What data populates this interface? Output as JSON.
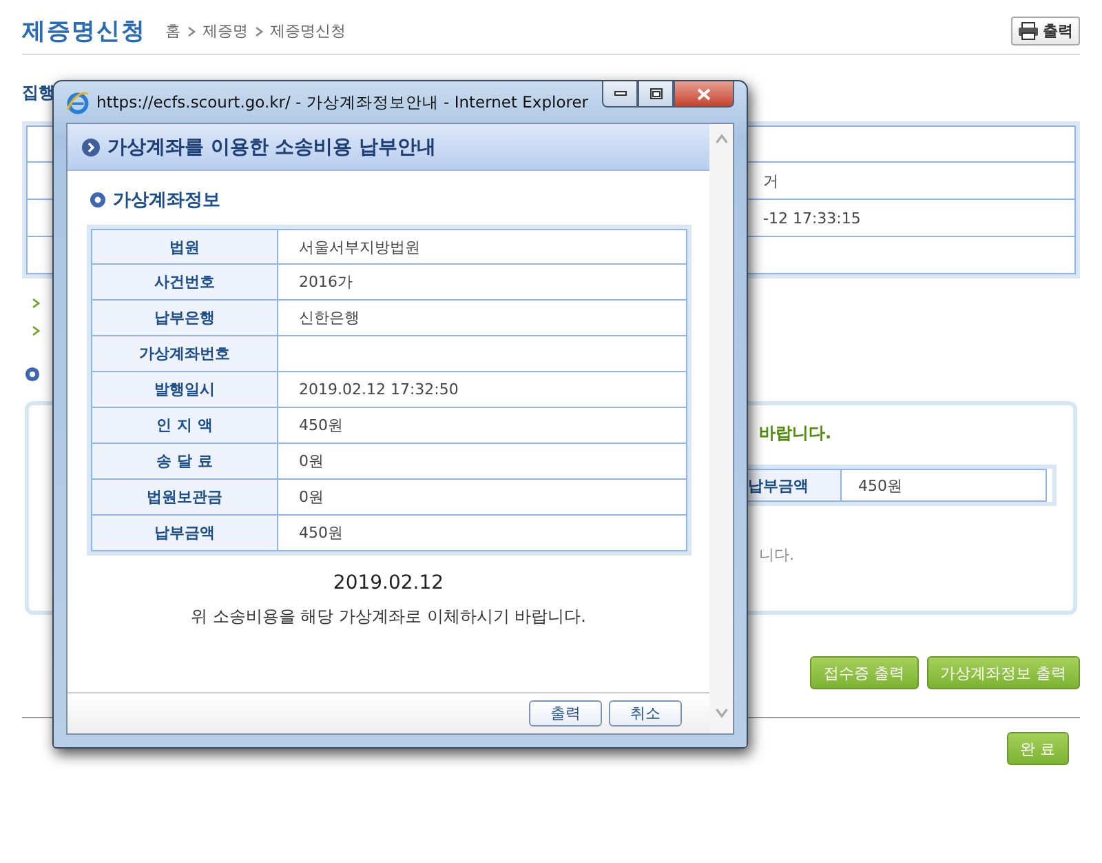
{
  "page": {
    "title": "제증명신청",
    "breadcrumb": [
      "홈",
      "제증명",
      "제증명신청"
    ],
    "print_button": "출력",
    "section_label": "집행",
    "info_rows": [
      {},
      {
        "value": "거"
      },
      {
        "value": "-12 17:33:15"
      },
      {}
    ],
    "notice": {
      "heading": "바랍니다.",
      "amount_label": "납부금액",
      "amount_value": "450원",
      "note": "니다."
    },
    "buttons": [
      "접수증 출력",
      "가상계좌정보 출력"
    ],
    "done_button": "완 료"
  },
  "popup": {
    "title": "https://ecfs.scourt.go.kr/ - 가상계좌정보안내 - Internet Explorer",
    "heading": "가상계좌를 이용한 소송비용 납부안내",
    "section": "가상계좌정보",
    "rows": [
      {
        "label": "법원",
        "value": "서울서부지방법원"
      },
      {
        "label": "사건번호",
        "value": "2016가"
      },
      {
        "label": "납부은행",
        "value": "신한은행"
      },
      {
        "label": "가상계좌번호"
      },
      {
        "label": "발행일시",
        "value": "2019.02.12 17:32:50"
      },
      {
        "label": "인 지 액",
        "value": "450원"
      },
      {
        "label": "송 달 료",
        "value": "0원"
      },
      {
        "label": "법원보관금",
        "value": "0원"
      },
      {
        "label": "납부금액",
        "value": "450원"
      }
    ],
    "date": "2019.02.12",
    "message": "위 소송비용을 해당 가상계좌로 이체하시기 바랍니다.",
    "buttons": [
      "출력",
      "취소"
    ]
  }
}
